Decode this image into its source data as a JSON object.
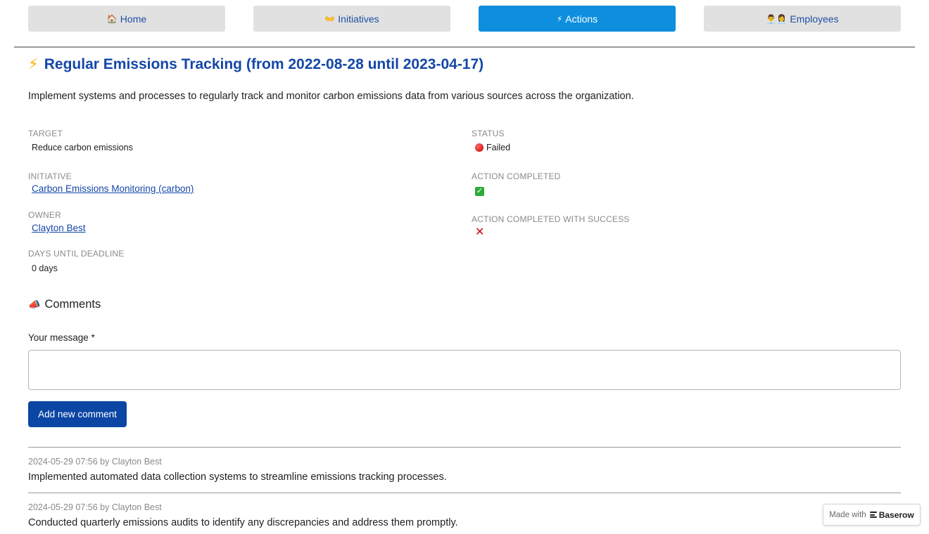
{
  "nav": {
    "items": [
      {
        "icon": "house-icon",
        "glyph": "🏠",
        "label": "Home",
        "active": false
      },
      {
        "icon": "handshake-icon",
        "glyph": "👐",
        "label": "Initiatives",
        "active": false
      },
      {
        "icon": "lightning-icon",
        "glyph": "⚡",
        "label": "Actions",
        "active": true
      },
      {
        "icon": "people-icon",
        "glyph": "👨‍💼👩‍💼",
        "label": "Employees",
        "active": false
      }
    ]
  },
  "action": {
    "title_icon": "lightning-icon",
    "title": "Regular Emissions Tracking (from 2022-08-28 until 2023-04-17)",
    "description": "Implement systems and processes to regularly track and monitor carbon emissions data from various sources across the organization."
  },
  "fields": {
    "target_label": "TARGET",
    "target_value": "Reduce carbon emissions",
    "initiative_label": "INITIATIVE",
    "initiative_value": "Carbon Emissions Monitoring (carbon)",
    "owner_label": "OWNER",
    "owner_value": "Clayton Best",
    "days_label": "DAYS UNTIL DEADLINE",
    "days_value": "0 days",
    "status_label": "STATUS",
    "status_value": "Failed",
    "status_color": "#d0021b",
    "completed_label": "ACTION COMPLETED",
    "completed_icon": "checkmark-icon",
    "completed_success_label": "ACTION COMPLETED WITH SUCCESS",
    "completed_success_icon": "cross-icon"
  },
  "comments": {
    "heading_icon": "megaphone-icon",
    "heading": "Comments",
    "message_label": "Your message *",
    "message_value": "",
    "add_button": "Add new comment",
    "list": [
      {
        "meta": "2024-05-29 07:56 by Clayton Best",
        "text": "Implemented automated data collection systems to streamline emissions tracking processes."
      },
      {
        "meta": "2024-05-29 07:56 by Clayton Best",
        "text": "Conducted quarterly emissions audits to identify any discrepancies and address them promptly."
      }
    ]
  },
  "footer": {
    "made_with": "Made with",
    "brand": "Baserow"
  },
  "colors": {
    "accent": "#0d8fde",
    "primary": "#0c46a4",
    "title": "#1447a8"
  }
}
